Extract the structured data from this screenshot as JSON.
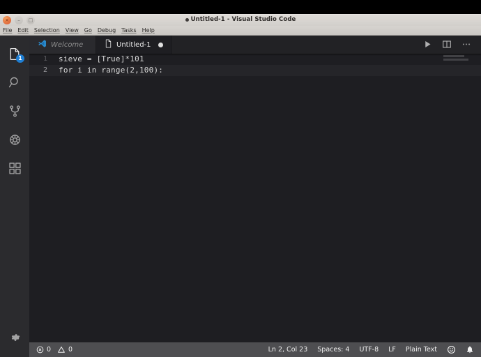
{
  "window": {
    "title": "Untitled-1 - Visual Studio Code",
    "buttons": {
      "close": "×",
      "minimize": "–",
      "maximize": "□"
    },
    "close_label": "close-window",
    "minimize_label": "minimize-window",
    "maximize_label": "maximize-window"
  },
  "menubar": {
    "items": [
      {
        "label": "File"
      },
      {
        "label": "Edit"
      },
      {
        "label": "Selection"
      },
      {
        "label": "View"
      },
      {
        "label": "Go"
      },
      {
        "label": "Debug"
      },
      {
        "label": "Tasks"
      },
      {
        "label": "Help"
      }
    ]
  },
  "activitybar": {
    "items": [
      {
        "name": "explorer",
        "icon": "files-icon",
        "badge": "1"
      },
      {
        "name": "search",
        "icon": "search-icon",
        "badge": ""
      },
      {
        "name": "source-control",
        "icon": "source-control-icon",
        "badge": ""
      },
      {
        "name": "debug",
        "icon": "debug-icon",
        "badge": ""
      },
      {
        "name": "extensions",
        "icon": "extensions-icon",
        "badge": ""
      }
    ],
    "settings": {
      "name": "manage-settings",
      "icon": "gear-icon"
    }
  },
  "tabs": [
    {
      "label": "Welcome",
      "icon": "vscode-logo-icon",
      "active": false,
      "dirty": false
    },
    {
      "label": "Untitled-1",
      "icon": "file-icon",
      "active": true,
      "dirty": true
    }
  ],
  "editor_actions": [
    {
      "name": "run-button",
      "icon": "play-icon"
    },
    {
      "name": "split-editor-button",
      "icon": "split-editor-icon"
    },
    {
      "name": "more-actions-button",
      "icon": "ellipsis-icon"
    }
  ],
  "editor": {
    "lines": [
      {
        "number": "1",
        "text": "sieve = [True]*101",
        "current": false
      },
      {
        "number": "2",
        "text": "for i in range(2,100):",
        "current": true
      }
    ]
  },
  "statusbar": {
    "errors": "0",
    "warnings": "0",
    "position": "Ln 2, Col 23",
    "indentation": "Spaces: 4",
    "encoding": "UTF-8",
    "eol": "LF",
    "language": "Plain Text",
    "feedback_icon": "smiley-icon",
    "notifications_icon": "bell-icon"
  },
  "colors": {
    "accent_blue": "#1f7fd4",
    "statusbar_bg": "#4e4e51",
    "editor_bg": "#1e1e22",
    "activitybar_bg": "#2b2b2e",
    "tabbar_bg": "#222225"
  }
}
